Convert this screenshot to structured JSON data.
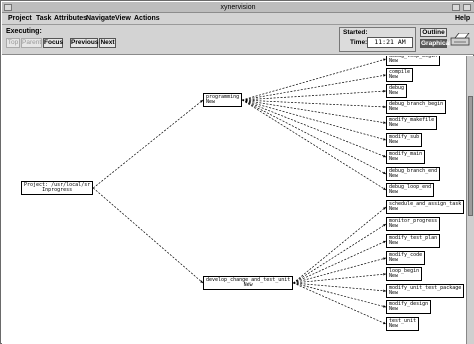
{
  "window": {
    "title": "xynervision"
  },
  "menubar": {
    "items": [
      "Project",
      "Task",
      "Attributes",
      "Navigate",
      "View",
      "Actions"
    ],
    "help": "Help"
  },
  "toolbar": {
    "executing_label": "Executing:",
    "top": "Top",
    "parent": "Parent",
    "focus": "Focus",
    "previous": "Previous",
    "next": "Next",
    "started_label": "Started:",
    "time_label": "Time:",
    "time_value": "11:21 AM",
    "outline": "Outline",
    "graphical": "Graphical"
  },
  "tree": {
    "root": {
      "line1": "Project: /usr/local/sr",
      "line2": "Inprogress"
    },
    "programming": {
      "line1": "programming",
      "line2": "New"
    },
    "develop": {
      "line1": "develop_change_and_test_unit",
      "line2": "New"
    },
    "programming_children": [
      {
        "line1": "debug_loop_begin",
        "line2": "New"
      },
      {
        "line1": "compile",
        "line2": "New"
      },
      {
        "line1": "debug",
        "line2": "New"
      },
      {
        "line1": "debug_branch_begin",
        "line2": "New"
      },
      {
        "line1": "modify_makefile",
        "line2": "New"
      },
      {
        "line1": "modify_sub",
        "line2": "New"
      },
      {
        "line1": "modify_main",
        "line2": "New"
      },
      {
        "line1": "debug_branch_end",
        "line2": "New"
      },
      {
        "line1": "debug_loop_end",
        "line2": "New"
      }
    ],
    "develop_children": [
      {
        "line1": "schedule_and_assign_task",
        "line2": "New"
      },
      {
        "line1": "monitor_progress",
        "line2": "New"
      },
      {
        "line1": "modify_test_plan",
        "line2": "New"
      },
      {
        "line1": "modify_code",
        "line2": "New"
      },
      {
        "line1": "loop_begin",
        "line2": "New"
      },
      {
        "line1": "modify_unit_test_package",
        "line2": "New"
      },
      {
        "line1": "modify_design",
        "line2": "New"
      },
      {
        "line1": "test_unit",
        "line2": "New"
      }
    ]
  }
}
